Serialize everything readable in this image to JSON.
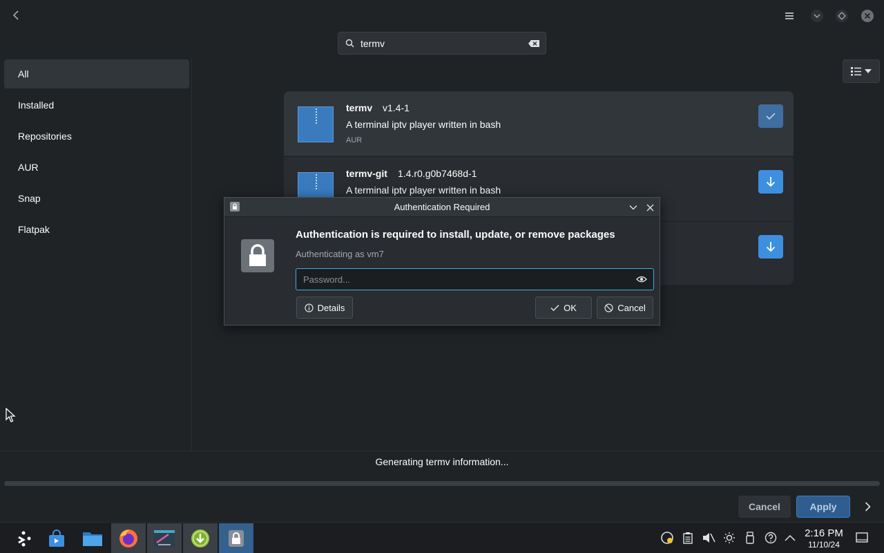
{
  "search": {
    "query": "termv"
  },
  "sidebar": {
    "items": [
      {
        "label": "All"
      },
      {
        "label": "Installed"
      },
      {
        "label": "Repositories"
      },
      {
        "label": "AUR"
      },
      {
        "label": "Snap"
      },
      {
        "label": "Flatpak"
      }
    ]
  },
  "packages": [
    {
      "name": "termv",
      "version": "v1.4-1",
      "description": "A terminal iptv player written in bash",
      "repo": "AUR",
      "state": "installed"
    },
    {
      "name": "termv-git",
      "version": "1.4.r0.g0b7468d-1",
      "description": "A terminal iptv player written in bash",
      "repo": "",
      "state": "download"
    },
    {
      "name": "",
      "version": "",
      "description": "",
      "repo": "",
      "state": "download"
    }
  ],
  "status": {
    "text": "Generating termv information..."
  },
  "progress": {
    "fraction": 0
  },
  "footer": {
    "cancel_label": "Cancel",
    "apply_label": "Apply"
  },
  "dialog": {
    "title": "Authentication Required",
    "heading": "Authentication is required to install, update, or remove packages",
    "subtitle": "Authenticating as vm7",
    "password_placeholder": "Password...",
    "details_label": "Details",
    "ok_label": "OK",
    "cancel_label": "Cancel"
  },
  "taskbar": {
    "time": "2:16 PM",
    "date": "11/10/24"
  },
  "colors": {
    "accent": "#3daee9",
    "background": "#202326",
    "download_button": "#3d8fe0"
  }
}
